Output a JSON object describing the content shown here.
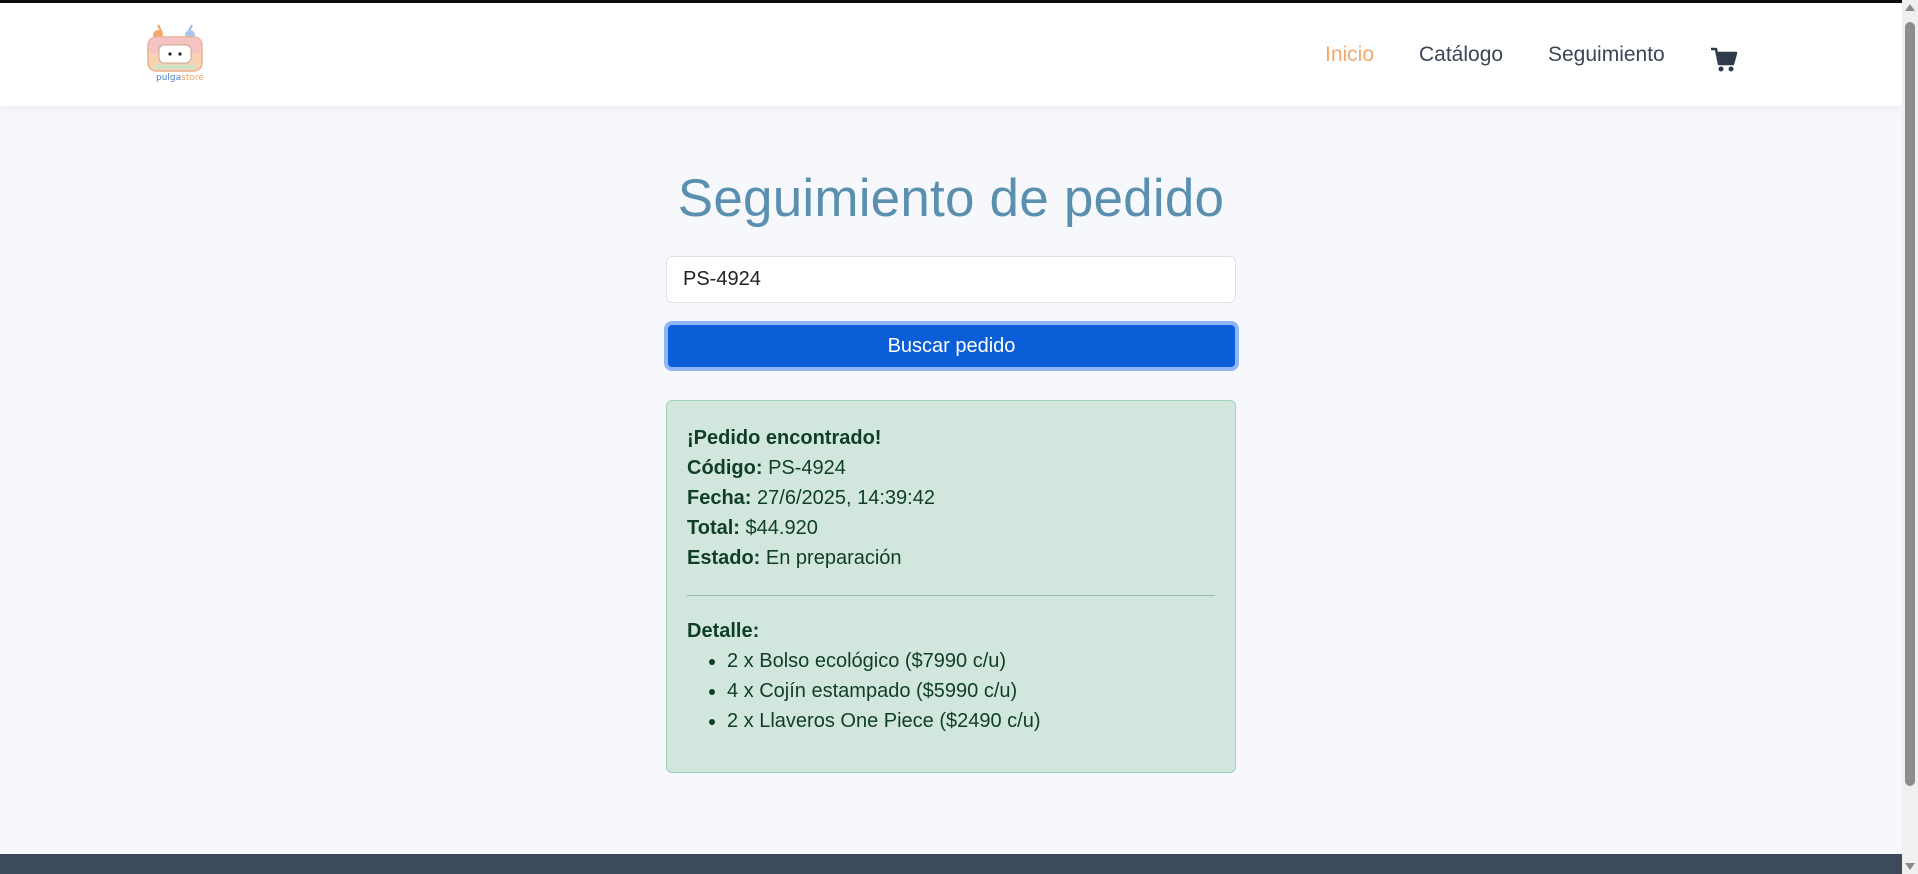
{
  "header": {
    "logo": {
      "text_part1": "pulga",
      "text_part2": "store"
    },
    "nav": {
      "inicio": "Inicio",
      "catalogo": "Catálogo",
      "seguimiento": "Seguimiento"
    },
    "cart_icon": "shopping-cart-icon",
    "active_color": "#f5a86b"
  },
  "main": {
    "title": "Seguimiento de pedido",
    "search": {
      "value": "PS-4924",
      "button_label": "Buscar pedido"
    },
    "result": {
      "heading": "¡Pedido encontrado!",
      "codigo_label": "Código:",
      "codigo_value": "PS-4924",
      "fecha_label": "Fecha:",
      "fecha_value": "27/6/2025, 14:39:42",
      "total_label": "Total:",
      "total_value": "$44.920",
      "estado_label": "Estado:",
      "estado_value": "En preparación",
      "detalle_label": "Detalle:",
      "items": [
        "2 x Bolso ecológico ($7990 c/u)",
        "4 x Cojín estampado ($5990 c/u)",
        "2 x Llaveros One Piece ($2490 c/u)"
      ]
    }
  },
  "colors": {
    "primary_button": "#0b5ed7",
    "title": "#5a8fb0",
    "success_bg": "#d1e7dd",
    "footer": "#3d4a5c"
  }
}
